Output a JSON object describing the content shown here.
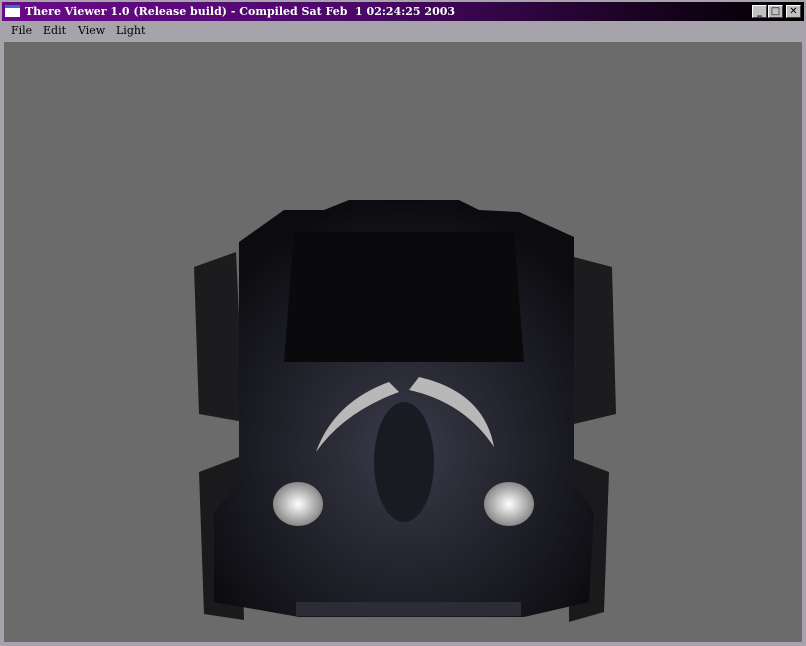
{
  "window": {
    "title": "There Viewer 1.0 (Release build) - Compiled Sat Feb  1 02:24:25 2003"
  },
  "menu": [
    {
      "label": "File"
    },
    {
      "label": "Edit"
    },
    {
      "label": "View"
    },
    {
      "label": "Light"
    }
  ],
  "controls": {
    "minimize": "_",
    "maximize": "□",
    "close": "✕"
  }
}
